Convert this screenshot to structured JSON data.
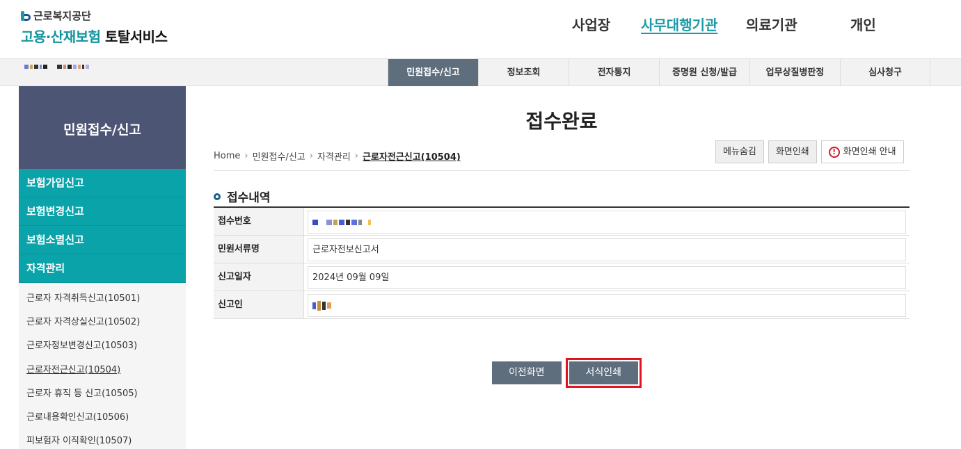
{
  "header": {
    "logo_org": "근로복지공단",
    "logo_main_teal": "고용·산재보험",
    "logo_main_dark": "토탈서비스",
    "gnb": [
      {
        "label": "사업장",
        "active": false
      },
      {
        "label": "사무대행기관",
        "active": true
      },
      {
        "label": "의료기관",
        "active": false
      },
      {
        "label": "개인",
        "active": false
      }
    ]
  },
  "subnav": {
    "tabs": [
      {
        "label": "민원접수/신고",
        "active": true
      },
      {
        "label": "정보조회",
        "active": false
      },
      {
        "label": "전자통지",
        "active": false
      },
      {
        "label": "증명원 신청/발급",
        "active": false
      },
      {
        "label": "업무상질병판정",
        "active": false
      },
      {
        "label": "심사청구",
        "active": false
      }
    ]
  },
  "sidebar": {
    "title": "민원접수/신고",
    "menu": [
      "보험가입신고",
      "보험변경신고",
      "보험소멸신고",
      "자격관리"
    ],
    "submenu": [
      {
        "label": "근로자 자격취득신고(10501)",
        "current": false
      },
      {
        "label": "근로자 자격상실신고(10502)",
        "current": false
      },
      {
        "label": "근로자정보변경신고(10503)",
        "current": false
      },
      {
        "label": "근로자전근신고(10504)",
        "current": true
      },
      {
        "label": "근로자 휴직 등 신고(10505)",
        "current": false
      },
      {
        "label": "근로내용확인신고(10506)",
        "current": false
      },
      {
        "label": "피보험자 이직확인(10507)",
        "current": false
      }
    ]
  },
  "main": {
    "title": "접수완료",
    "breadcrumb": [
      "Home",
      "민원접수/신고",
      "자격관리",
      "근로자전근신고(10504)"
    ],
    "util_buttons": {
      "hide_menu": "메뉴숨김",
      "print": "화면인쇄",
      "print_guide": "화면인쇄 안내"
    },
    "section_title": "접수내역",
    "fields": [
      {
        "label": "접수번호",
        "value": ""
      },
      {
        "label": "민원서류명",
        "value": "근로자전보신고서"
      },
      {
        "label": "신고일자",
        "value": "2024년 09월 09일"
      },
      {
        "label": "신고인",
        "value": ""
      }
    ],
    "buttons": {
      "prev": "이전화면",
      "print_form": "서식인쇄"
    }
  },
  "colors": {
    "accent": "#0aa3aa",
    "nav_active": "#5f6e7d",
    "sidebar_hero": "#4d5575",
    "highlight": "#e0141e"
  }
}
